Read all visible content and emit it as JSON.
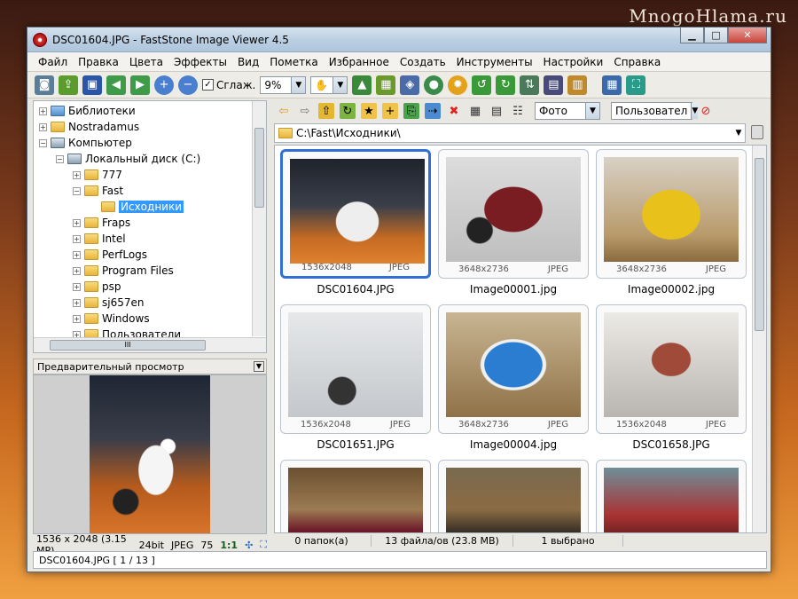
{
  "watermark": "MnogoHlama.ru",
  "window": {
    "title": "DSC01604.JPG  -  FastStone Image Viewer 4.5"
  },
  "menu": [
    "Файл",
    "Правка",
    "Цвета",
    "Эффекты",
    "Вид",
    "Пометка",
    "Избранное",
    "Создать",
    "Инструменты",
    "Настройки",
    "Справка"
  ],
  "toolbar": {
    "smooth_label": "Сглаж.",
    "zoom_value": "9%"
  },
  "nav": {
    "filter_value": "Фото",
    "sort_value": "Пользовател"
  },
  "tree": [
    {
      "label": "Библиотеки",
      "indent": 0,
      "toggle": "+",
      "type": "lib"
    },
    {
      "label": "Nostradamus",
      "indent": 0,
      "toggle": "+",
      "type": "folder"
    },
    {
      "label": "Компьютер",
      "indent": 0,
      "toggle": "−",
      "type": "pc"
    },
    {
      "label": "Локальный диск (C:)",
      "indent": 1,
      "toggle": "−",
      "type": "pc"
    },
    {
      "label": "777",
      "indent": 2,
      "toggle": "+",
      "type": "folder"
    },
    {
      "label": "Fast",
      "indent": 2,
      "toggle": "−",
      "type": "folder"
    },
    {
      "label": "Исходники",
      "indent": 3,
      "toggle": "",
      "type": "folder",
      "selected": true
    },
    {
      "label": "Fraps",
      "indent": 2,
      "toggle": "+",
      "type": "folder"
    },
    {
      "label": "Intel",
      "indent": 2,
      "toggle": "+",
      "type": "folder"
    },
    {
      "label": "PerfLogs",
      "indent": 2,
      "toggle": "+",
      "type": "folder"
    },
    {
      "label": "Program Files",
      "indent": 2,
      "toggle": "+",
      "type": "folder"
    },
    {
      "label": "psp",
      "indent": 2,
      "toggle": "+",
      "type": "folder"
    },
    {
      "label": "sj657en",
      "indent": 2,
      "toggle": "+",
      "type": "folder"
    },
    {
      "label": "Windows",
      "indent": 2,
      "toggle": "+",
      "type": "folder"
    },
    {
      "label": "Пользователи",
      "indent": 2,
      "toggle": "+",
      "type": "folder"
    }
  ],
  "preview": {
    "header": "Предварительный просмотр",
    "status": [
      "1536 x 2048 (3.15 MP)",
      "24bit",
      "JPEG",
      "75"
    ],
    "scale": "1:1"
  },
  "path": "C:\\Fast\\Исходники\\",
  "thumbnails": [
    {
      "name": "DSC01604.JPG",
      "dims": "1536x2048",
      "fmt": "JPEG",
      "selected": true,
      "style": "t-bike"
    },
    {
      "name": "Image00001.jpg",
      "dims": "3648x2736",
      "fmt": "JPEG",
      "style": "t-redcar"
    },
    {
      "name": "Image00002.jpg",
      "dims": "3648x2736",
      "fmt": "JPEG",
      "style": "t-uaz"
    },
    {
      "name": "DSC01651.JPG",
      "dims": "1536x2048",
      "fmt": "JPEG",
      "style": "t-chopper"
    },
    {
      "name": "Image00004.jpg",
      "dims": "3648x2736",
      "fmt": "JPEG",
      "style": "t-bus"
    },
    {
      "name": "DSC01658.JPG",
      "dims": "1536x2048",
      "fmt": "JPEG",
      "style": "t-redmoto"
    },
    {
      "name": "",
      "dims": "",
      "fmt": "",
      "style": "t-rowcar1"
    },
    {
      "name": "",
      "dims": "",
      "fmt": "",
      "style": "t-rowcar2"
    },
    {
      "name": "",
      "dims": "",
      "fmt": "",
      "style": "t-rowcar3"
    }
  ],
  "status": {
    "folders": "0 папок(а)",
    "files": "13 файла/ов (23.8 MB)",
    "selected": "1 выбрано"
  },
  "bottom": "DSC01604.JPG [ 1 / 13 ]"
}
